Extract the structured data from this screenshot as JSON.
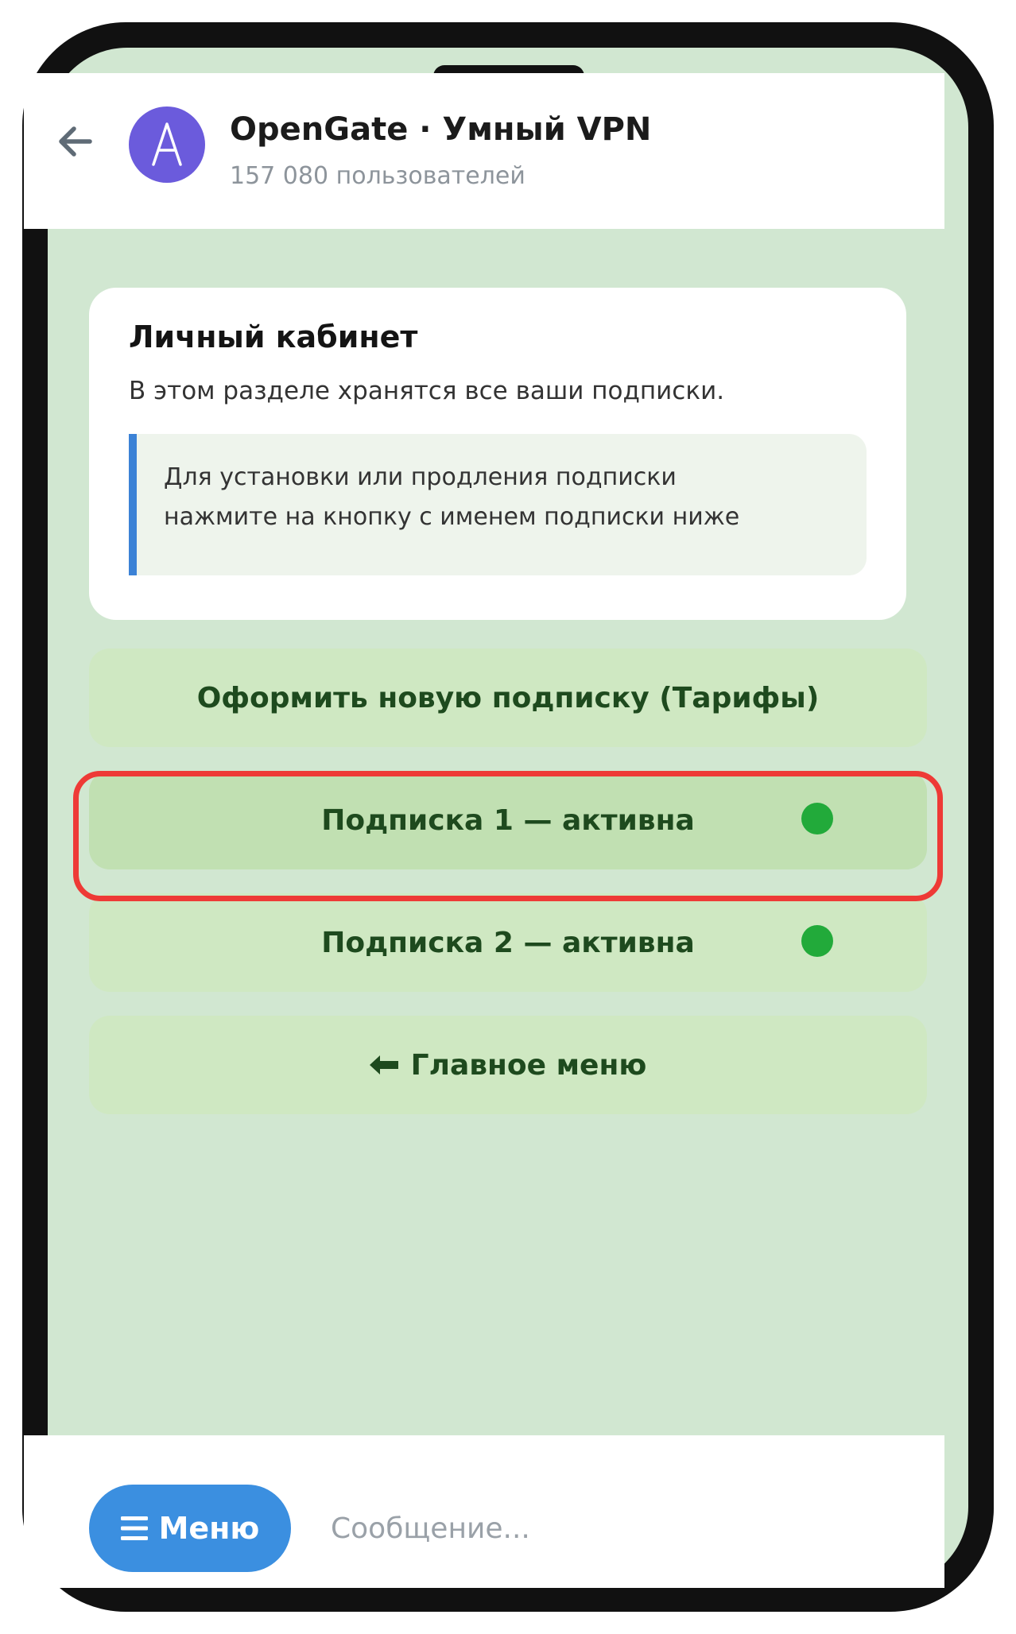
{
  "chat": {
    "title": "OpenGate · Умный VPN",
    "subtitle": "157 080 пользователей",
    "avatar_letter": "A",
    "avatar_color": "#6b5bdc"
  },
  "card": {
    "title": "Личный кабинет",
    "description": "В этом разделе хранятся все ваши подписки.",
    "note_line1": "Для установки или продления подписки",
    "note_line2": "нажмите на кнопку с именем подписки ниже"
  },
  "buttons": {
    "new_subscription": "Оформить новую подписку (Тарифы)",
    "subscription_1": "Подписка 1 — активна",
    "subscription_2": "Подписка 2 — активна",
    "main_menu": "Главное меню"
  },
  "statuses": {
    "subscription_1": "active",
    "subscription_2": "active",
    "active_color": "#22aa3a"
  },
  "highlight": {
    "target": "subscription_1",
    "color": "#ee3a36"
  },
  "footer": {
    "menu_label": "Меню",
    "message_placeholder": "Сообщение..."
  },
  "icons": {
    "back": "arrow-left-icon",
    "menu": "hamburger-icon",
    "main_menu": "arrow-left-bold-icon",
    "status": "green-dot-icon"
  }
}
